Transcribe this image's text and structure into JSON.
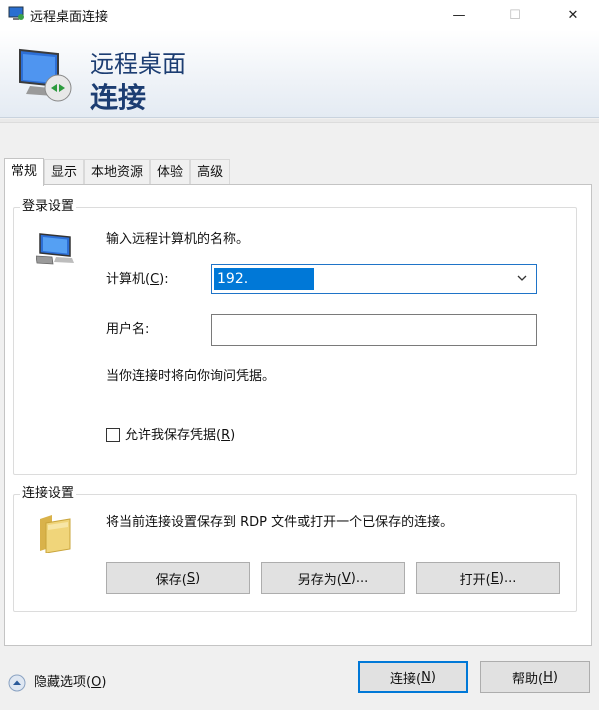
{
  "window": {
    "title": "远程桌面连接",
    "controls": {
      "minimize": "—",
      "maximize": "☐",
      "close": "✕"
    }
  },
  "banner": {
    "line1": "远程桌面",
    "line2": "连接"
  },
  "tabs": [
    {
      "label": "常规",
      "active": true
    },
    {
      "label": "显示",
      "active": false
    },
    {
      "label": "本地资源",
      "active": false
    },
    {
      "label": "体验",
      "active": false
    },
    {
      "label": "高级",
      "active": false
    }
  ],
  "login_settings": {
    "legend": "登录设置",
    "instruction": "输入远程计算机的名称。",
    "computer": {
      "label": "计算机(",
      "accel": "C",
      "label_end": "):",
      "value": "192."
    },
    "username": {
      "label": "用户名:",
      "value": ""
    },
    "notice": "当你连接时将向你询问凭据。",
    "save_credentials": {
      "label": "允许我保存凭据(",
      "accel": "R",
      "label_end": ")",
      "checked": false
    }
  },
  "connection_settings": {
    "legend": "连接设置",
    "description": "将当前连接设置保存到 RDP 文件或打开一个已保存的连接。",
    "save": {
      "label": "保存(",
      "accel": "S",
      "label_end": ")"
    },
    "save_as": {
      "label": "另存为(",
      "accel": "V",
      "label_end": ")..."
    },
    "open": {
      "label": "打开(",
      "accel": "E",
      "label_end": ")..."
    }
  },
  "footer": {
    "hide_options": {
      "label": "隐藏选项(",
      "accel": "O",
      "label_end": ")"
    },
    "connect": {
      "label": "连接(",
      "accel": "N",
      "label_end": ")"
    },
    "help": {
      "label": "帮助(",
      "accel": "H",
      "label_end": ")"
    }
  },
  "colors": {
    "accent": "#0078d7",
    "banner_text": "#1c3d72"
  },
  "icons": [
    "remote-desktop-app-icon",
    "remote-desktop-logo-icon",
    "computer-icon",
    "folder-icon",
    "collapse-arrow-icon",
    "chevron-down-icon"
  ]
}
